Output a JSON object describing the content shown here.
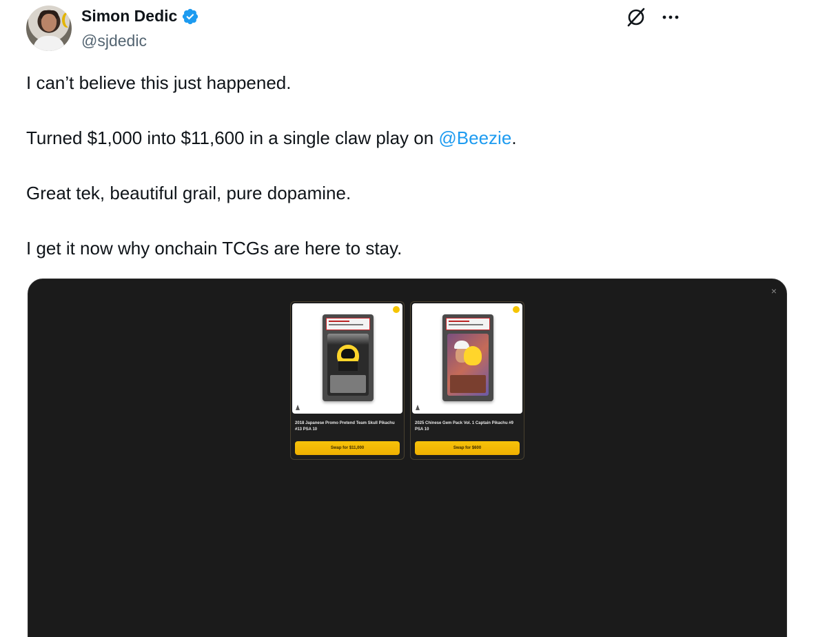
{
  "author": {
    "name": "Simon Dedic",
    "handle": "@sjdedic",
    "verified": true
  },
  "tweet": {
    "line1": "I can’t believe this just happened.",
    "line2_before": "Turned $1,000 into $11,600 in a single claw play on ",
    "line2_mention": "@Beezie",
    "line2_after": ".",
    "line3": "Great tek, beautiful grail, pure dopamine.",
    "line4": "I get it now why onchain TCGs are here to stay."
  },
  "media": {
    "close_label": "×",
    "cards": [
      {
        "title": "2018 Japanese Promo Pretend Team Skull Pikachu #13 PSA 10",
        "button": "Swap for $11,000"
      },
      {
        "title": "2025 Chinese Gem Pack Vol. 1 Captain Pikachu #9 PSA 10",
        "button": "Swap for $600"
      }
    ]
  },
  "colors": {
    "accent": "#1d9bf0",
    "verified": "#1d9bf0",
    "media_bg": "#1b1b1b",
    "button": "#f5bf0a"
  },
  "icons": {
    "verified": "verified-badge-icon",
    "grok": "grok-icon",
    "more": "more-icon"
  }
}
